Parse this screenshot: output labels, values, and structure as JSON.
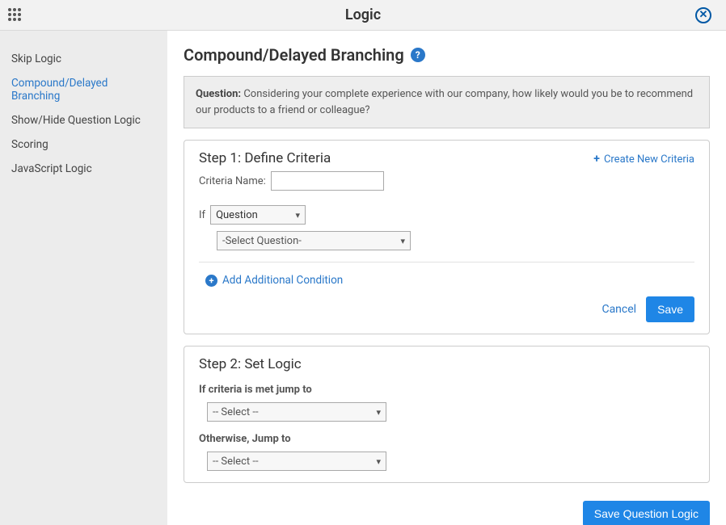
{
  "header": {
    "title": "Logic"
  },
  "sidebar": {
    "items": [
      {
        "label": "Skip Logic"
      },
      {
        "label": "Compound/Delayed Branching"
      },
      {
        "label": "Show/Hide Question Logic"
      },
      {
        "label": "Scoring"
      },
      {
        "label": "JavaScript Logic"
      }
    ]
  },
  "page": {
    "heading": "Compound/Delayed Branching",
    "question_label": "Question:",
    "question_text": "Considering your complete experience with our company, how likely would you be to recommend our products to a friend or colleague?"
  },
  "step1": {
    "title": "Step 1: Define Criteria",
    "create_link": "Create New Criteria",
    "criteria_name_label": "Criteria Name:",
    "criteria_name_value": "",
    "if_label": "If",
    "if_type_selected": "Question",
    "question_selected": "-Select Question-",
    "add_condition": "Add Additional Condition",
    "cancel_label": "Cancel",
    "save_label": "Save"
  },
  "step2": {
    "title": "Step 2: Set Logic",
    "if_met_label": "If criteria is met jump to",
    "if_met_selected": "-- Select --",
    "otherwise_label": "Otherwise, Jump to",
    "otherwise_selected": "-- Select --"
  },
  "footer": {
    "save_question_logic": "Save Question Logic"
  }
}
